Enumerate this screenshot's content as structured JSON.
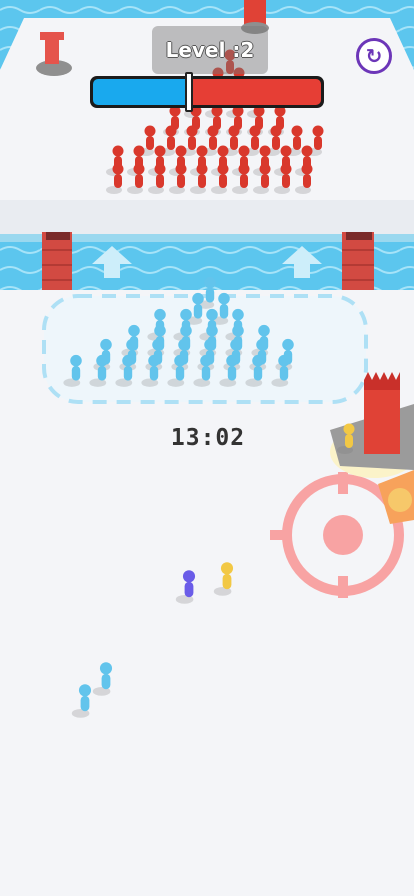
{
  "hud": {
    "level_label": "Level :2",
    "timer": "13:02",
    "restart_icon": "restart-icon"
  },
  "tug_of_war": {
    "blue_share": 0.42,
    "red_share": 0.58,
    "blue_color": "#19a9ee",
    "red_color": "#e63e35"
  },
  "colors": {
    "water": "#5cc6ee",
    "floor": "#f2f3f7",
    "player_crowd": "#62c4ec",
    "enemy_crowd": "#d9382c",
    "target": "#f8a3a3"
  }
}
